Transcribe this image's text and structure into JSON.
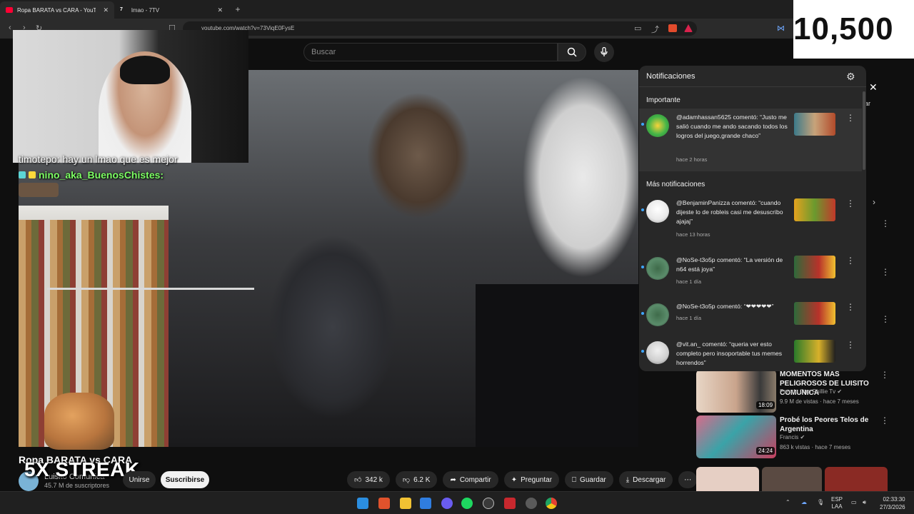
{
  "browser": {
    "tabs": [
      {
        "label": "Ropa BARATA vs CARA - YouTube",
        "active": true
      },
      {
        "label": "lmao - 7TV",
        "active": false
      }
    ],
    "new_tab": "+",
    "url": "youtube.com/watch?v=73ViqE0FysE"
  },
  "youtube": {
    "search_placeholder": "Buscar",
    "video_title": "Ropa BARATA vs CARA",
    "channel_name": "Luisito Comunica",
    "subscribers": "45.7 M de suscriptores",
    "join_label": "Unirse",
    "subscribe_label": "Suscribirse",
    "actions": [
      {
        "icon": "thumbs-up-icon",
        "label": "342 k"
      },
      {
        "icon": "thumbs-down-icon",
        "label": "6.2 K"
      },
      {
        "icon": "share-icon",
        "label": "Compartir"
      },
      {
        "icon": "sparkle-icon",
        "label": "Preguntar"
      },
      {
        "icon": "bookmark-icon",
        "label": "Guardar"
      },
      {
        "icon": "download-icon",
        "label": "Descargar"
      }
    ],
    "more_label": "⋯",
    "partial_pill": "orrar"
  },
  "stream_overlay": {
    "counter": "10,500",
    "chat_line1": "timotepo: hay un lmao que es mejor",
    "chat_user": "nino_aka_BuenosChistes:",
    "streak": "5X STREAK"
  },
  "notifications": {
    "title": "Notificaciones",
    "important_label": "Importante",
    "more_label": "Más notificaciones",
    "important": [
      {
        "text": "@adamhassan5625 comentó: “Justo me salió cuando me ando sacando todos los logros del juego,grande chaco”",
        "time": "hace 2 horas"
      }
    ],
    "items": [
      {
        "text": "@BenjaminPanizza comentó: “cuando dijeste lo de robleis casi me desuscribo ajajaj”",
        "time": "hace 13 horas"
      },
      {
        "text": "@NoSe-t3o5p comentó: “La versión de n64 está joya”",
        "time": "hace 1 día"
      },
      {
        "text": "@NoSe-t3o5p comentó: “❤❤❤❤❤”",
        "time": "hace 1 día"
      },
      {
        "text": "@vit.an_ comentó: “queria ver esto completo pero insoportable tus memes horrendos”",
        "time": ""
      }
    ]
  },
  "recommendations": [
    {
      "title": "MOMENTOS MAS PELIGROSOS DE LUISITO COMUNICA",
      "channel": "Prende Otro Phillie Tv ✔",
      "meta": "9.9 M de vistas · hace 7 meses",
      "duration": "18:09"
    },
    {
      "title": "Probé los Peores Telos de Argentina",
      "channel": "Francis ✔",
      "meta": "863 k vistas · hace 7 meses",
      "duration": "24:24"
    }
  ],
  "taskbar": {
    "lang_top": "ESP",
    "lang_bottom": "LAA",
    "time": "02:33:30",
    "date": "27/3/2026"
  },
  "colors": {
    "yt_bg": "#0f0f0f",
    "panel_bg": "#282828",
    "chat_user": "#7dff64",
    "accent_red": "#ff0033"
  }
}
